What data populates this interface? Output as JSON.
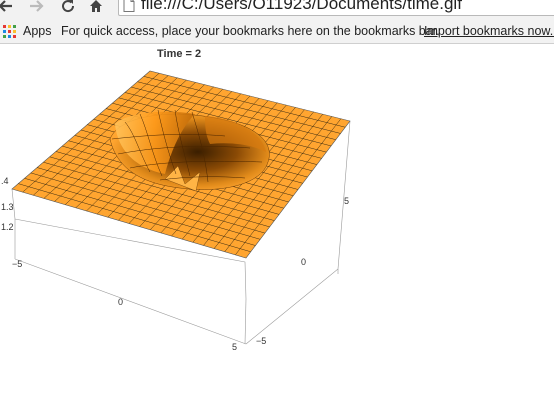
{
  "browser": {
    "url": "file:///C:/Users/O11923/Documents/time.gif",
    "apps_label": "Apps",
    "bookmarks_message": "For quick access, place your bookmarks here on the bookmarks bar.",
    "import_link": "Import bookmarks now..."
  },
  "plot": {
    "title": "Time = 2",
    "z_ticks": [
      ".4",
      "1.3",
      "1.2"
    ],
    "x_ticks": [
      "−5",
      "0",
      "5"
    ],
    "y_ticks": [
      "5",
      "0",
      "−5"
    ],
    "surface_color": "#ffa530"
  }
}
